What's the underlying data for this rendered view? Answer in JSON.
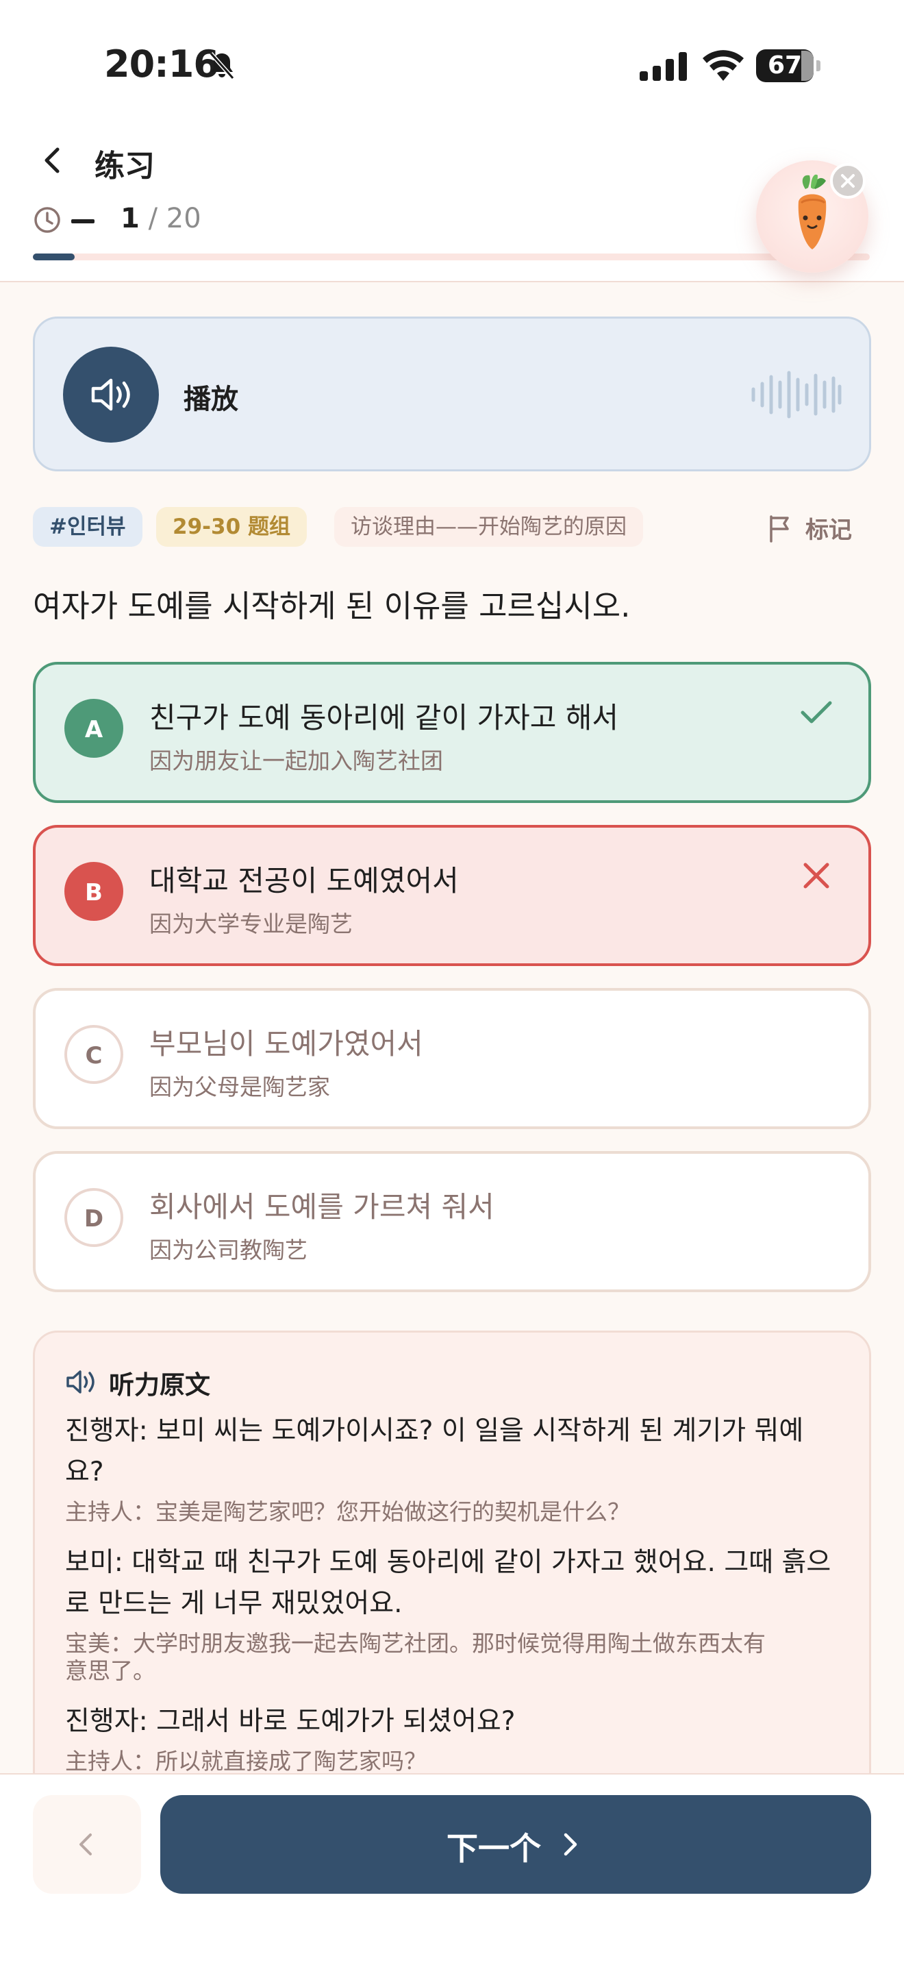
{
  "status_bar": {
    "time": "20:16",
    "battery": "67"
  },
  "header": {
    "title": "练习",
    "timer": "—",
    "counter_current": "1",
    "counter_total": "/ 20",
    "progress": 0.05
  },
  "audio": {
    "play_label": "播放"
  },
  "tags": {
    "topic": "#인터뷰",
    "group": "29-30 题组",
    "description": "访谈理由——开始陶艺的原因"
  },
  "flag_label": "标记",
  "question": "여자가 도예를 시작하게 된 이유를 고르십시오.",
  "options": [
    {
      "letter": "A",
      "text": "친구가 도예 동아리에 같이 가자고 해서",
      "translation": "因为朋友让一起加入陶艺社团",
      "state": "correct"
    },
    {
      "letter": "B",
      "text": "대학교 전공이 도예였어서",
      "translation": "因为大学专业是陶艺",
      "state": "wrong"
    },
    {
      "letter": "C",
      "text": "부모님이 도예가였어서",
      "translation": "因为父母是陶艺家",
      "state": "neutral"
    },
    {
      "letter": "D",
      "text": "회사에서 도예를 가르쳐 줘서",
      "translation": "因为公司教陶艺",
      "state": "neutral"
    }
  ],
  "transcript": {
    "title": "听力原文",
    "lines": [
      {
        "line1": "진행자: 보미 씨는 도예가이시죠? 이 일을 시작하게 된 계기가 뭐예",
        "line2": "요?",
        "translation1": "主持人：宝美是陶艺家吧？您开始做这行的契机是什么？",
        "translation2": ""
      },
      {
        "line1": "보미: 대학교 때 친구가 도예 동아리에 같이 가자고 했어요. 그때 흙으",
        "line2": "로 만드는 게 너무 재밌었어요.",
        "translation1": "宝美：大学时朋友邀我一起去陶艺社团。那时候觉得用陶土做东西太有",
        "translation2": "意思了。"
      },
      {
        "line1": "진행자: 그래서 바로 도예가가 되셨어요?",
        "line2": "",
        "translation1": "主持人：所以就直接成了陶艺家吗？",
        "translation2": ""
      }
    ]
  },
  "footer": {
    "next_label": "下一个"
  },
  "colors": {
    "primary": "#34506d",
    "correct": "#4e9a78",
    "wrong": "#d9534f",
    "background": "#fdf8f4"
  }
}
